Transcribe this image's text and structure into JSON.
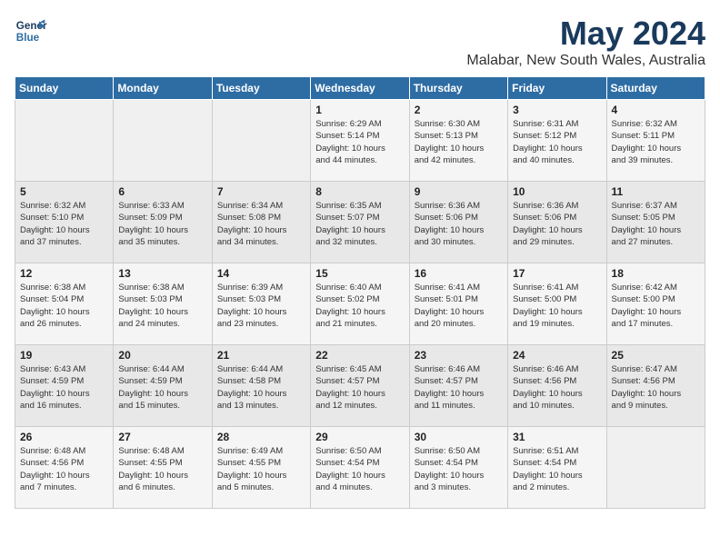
{
  "header": {
    "logo_line1": "General",
    "logo_line2": "Blue",
    "title": "May 2024",
    "subtitle": "Malabar, New South Wales, Australia"
  },
  "days_of_week": [
    "Sunday",
    "Monday",
    "Tuesday",
    "Wednesday",
    "Thursday",
    "Friday",
    "Saturday"
  ],
  "weeks": [
    [
      {
        "day": "",
        "info": ""
      },
      {
        "day": "",
        "info": ""
      },
      {
        "day": "",
        "info": ""
      },
      {
        "day": "1",
        "info": "Sunrise: 6:29 AM\nSunset: 5:14 PM\nDaylight: 10 hours\nand 44 minutes."
      },
      {
        "day": "2",
        "info": "Sunrise: 6:30 AM\nSunset: 5:13 PM\nDaylight: 10 hours\nand 42 minutes."
      },
      {
        "day": "3",
        "info": "Sunrise: 6:31 AM\nSunset: 5:12 PM\nDaylight: 10 hours\nand 40 minutes."
      },
      {
        "day": "4",
        "info": "Sunrise: 6:32 AM\nSunset: 5:11 PM\nDaylight: 10 hours\nand 39 minutes."
      }
    ],
    [
      {
        "day": "5",
        "info": "Sunrise: 6:32 AM\nSunset: 5:10 PM\nDaylight: 10 hours\nand 37 minutes."
      },
      {
        "day": "6",
        "info": "Sunrise: 6:33 AM\nSunset: 5:09 PM\nDaylight: 10 hours\nand 35 minutes."
      },
      {
        "day": "7",
        "info": "Sunrise: 6:34 AM\nSunset: 5:08 PM\nDaylight: 10 hours\nand 34 minutes."
      },
      {
        "day": "8",
        "info": "Sunrise: 6:35 AM\nSunset: 5:07 PM\nDaylight: 10 hours\nand 32 minutes."
      },
      {
        "day": "9",
        "info": "Sunrise: 6:36 AM\nSunset: 5:06 PM\nDaylight: 10 hours\nand 30 minutes."
      },
      {
        "day": "10",
        "info": "Sunrise: 6:36 AM\nSunset: 5:06 PM\nDaylight: 10 hours\nand 29 minutes."
      },
      {
        "day": "11",
        "info": "Sunrise: 6:37 AM\nSunset: 5:05 PM\nDaylight: 10 hours\nand 27 minutes."
      }
    ],
    [
      {
        "day": "12",
        "info": "Sunrise: 6:38 AM\nSunset: 5:04 PM\nDaylight: 10 hours\nand 26 minutes."
      },
      {
        "day": "13",
        "info": "Sunrise: 6:38 AM\nSunset: 5:03 PM\nDaylight: 10 hours\nand 24 minutes."
      },
      {
        "day": "14",
        "info": "Sunrise: 6:39 AM\nSunset: 5:03 PM\nDaylight: 10 hours\nand 23 minutes."
      },
      {
        "day": "15",
        "info": "Sunrise: 6:40 AM\nSunset: 5:02 PM\nDaylight: 10 hours\nand 21 minutes."
      },
      {
        "day": "16",
        "info": "Sunrise: 6:41 AM\nSunset: 5:01 PM\nDaylight: 10 hours\nand 20 minutes."
      },
      {
        "day": "17",
        "info": "Sunrise: 6:41 AM\nSunset: 5:00 PM\nDaylight: 10 hours\nand 19 minutes."
      },
      {
        "day": "18",
        "info": "Sunrise: 6:42 AM\nSunset: 5:00 PM\nDaylight: 10 hours\nand 17 minutes."
      }
    ],
    [
      {
        "day": "19",
        "info": "Sunrise: 6:43 AM\nSunset: 4:59 PM\nDaylight: 10 hours\nand 16 minutes."
      },
      {
        "day": "20",
        "info": "Sunrise: 6:44 AM\nSunset: 4:59 PM\nDaylight: 10 hours\nand 15 minutes."
      },
      {
        "day": "21",
        "info": "Sunrise: 6:44 AM\nSunset: 4:58 PM\nDaylight: 10 hours\nand 13 minutes."
      },
      {
        "day": "22",
        "info": "Sunrise: 6:45 AM\nSunset: 4:57 PM\nDaylight: 10 hours\nand 12 minutes."
      },
      {
        "day": "23",
        "info": "Sunrise: 6:46 AM\nSunset: 4:57 PM\nDaylight: 10 hours\nand 11 minutes."
      },
      {
        "day": "24",
        "info": "Sunrise: 6:46 AM\nSunset: 4:56 PM\nDaylight: 10 hours\nand 10 minutes."
      },
      {
        "day": "25",
        "info": "Sunrise: 6:47 AM\nSunset: 4:56 PM\nDaylight: 10 hours\nand 9 minutes."
      }
    ],
    [
      {
        "day": "26",
        "info": "Sunrise: 6:48 AM\nSunset: 4:56 PM\nDaylight: 10 hours\nand 7 minutes."
      },
      {
        "day": "27",
        "info": "Sunrise: 6:48 AM\nSunset: 4:55 PM\nDaylight: 10 hours\nand 6 minutes."
      },
      {
        "day": "28",
        "info": "Sunrise: 6:49 AM\nSunset: 4:55 PM\nDaylight: 10 hours\nand 5 minutes."
      },
      {
        "day": "29",
        "info": "Sunrise: 6:50 AM\nSunset: 4:54 PM\nDaylight: 10 hours\nand 4 minutes."
      },
      {
        "day": "30",
        "info": "Sunrise: 6:50 AM\nSunset: 4:54 PM\nDaylight: 10 hours\nand 3 minutes."
      },
      {
        "day": "31",
        "info": "Sunrise: 6:51 AM\nSunset: 4:54 PM\nDaylight: 10 hours\nand 2 minutes."
      },
      {
        "day": "",
        "info": ""
      }
    ]
  ]
}
